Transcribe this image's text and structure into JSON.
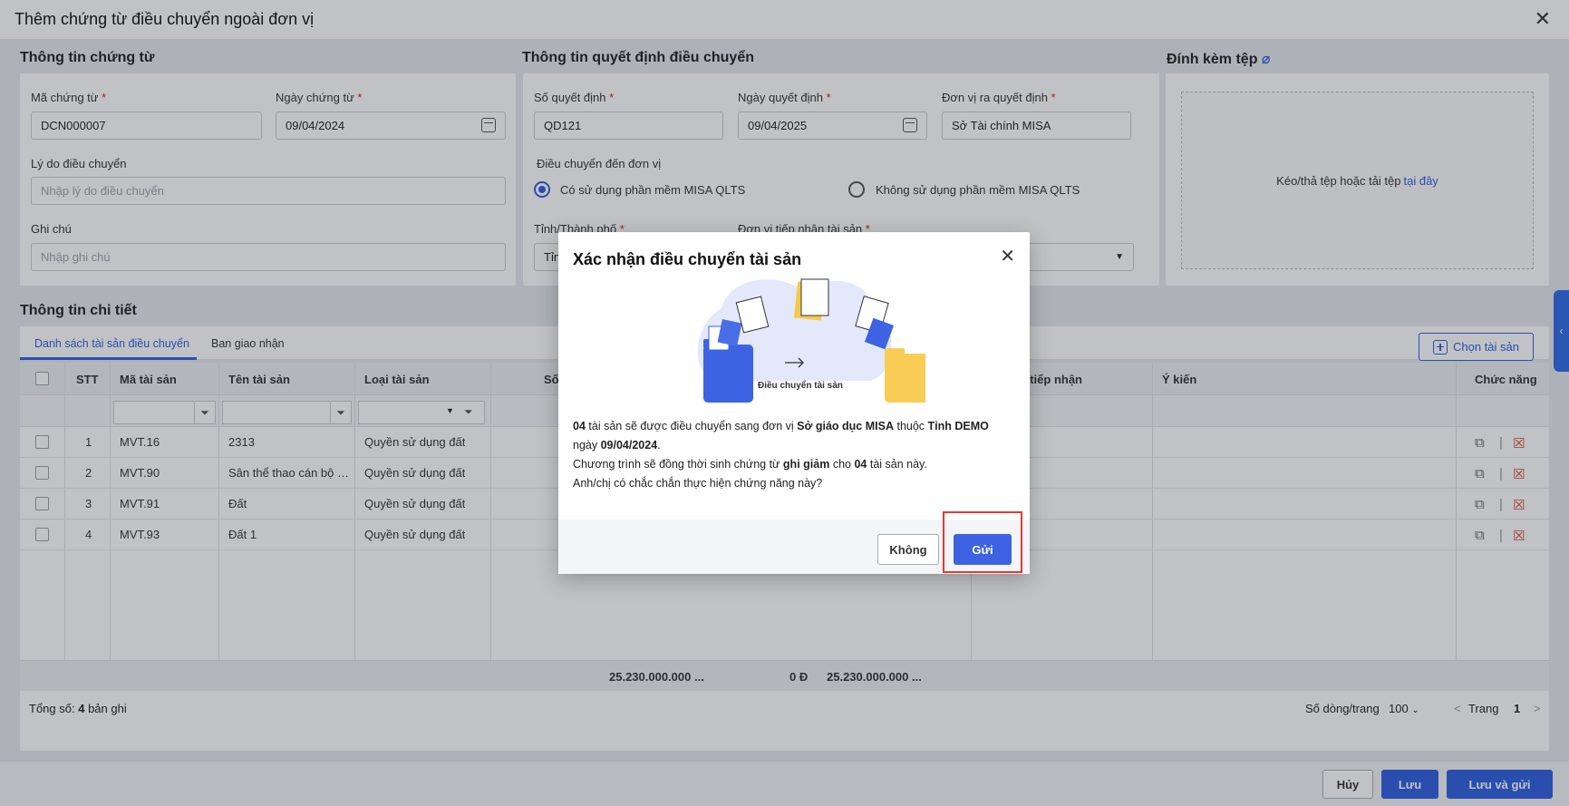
{
  "window": {
    "title": "Thêm chứng từ điều chuyển ngoài đơn vị"
  },
  "voucher_info": {
    "section_title": "Thông tin chứng từ",
    "code_label": "Mã chứng từ",
    "code_value": "DCN000007",
    "date_label": "Ngày chứng từ",
    "date_value": "09/04/2024",
    "reason_label": "Lý do điều chuyển",
    "reason_placeholder": "Nhập lý do điều chuyển",
    "note_label": "Ghi chú",
    "note_placeholder": "Nhập ghi chú"
  },
  "decision_info": {
    "section_title": "Thông tin quyết định điều chuyển",
    "number_label": "Số quyết định",
    "number_value": "QD121",
    "date_label": "Ngày quyết định",
    "date_value": "09/04/2025",
    "issuer_label": "Đơn vị ra quyết định",
    "issuer_value": "Sở Tài chính MISA",
    "transfer_to_label": "Điều chuyển đến đơn vị",
    "option_use": "Có sử dụng phần mềm MISA QLTS",
    "option_not_use": "Không sử dụng phần mềm MISA QLTS",
    "province_label": "Tỉnh/Thành phố",
    "province_value": "Tỉn",
    "receiver_label": "Đơn vị tiếp nhận tài sản"
  },
  "attachment": {
    "section_title": "Đính kèm tệp",
    "drop_text": "Kéo/thả tệp hoặc tải tệp",
    "drop_link": "tại đây"
  },
  "detail": {
    "section_title": "Thông tin chi tiết",
    "tabs": [
      {
        "label": "Danh sách tài sản điều chuyển"
      },
      {
        "label": "Ban giao nhận"
      }
    ],
    "choose_button": "Chọn tài sản",
    "columns": {
      "stt": "STT",
      "code": "Mã tài sản",
      "name": "Tên tài sản",
      "type": "Loại tài sản",
      "so": "Số",
      "receiver_unit": "i tiếp nhận",
      "opinion": "Ý kiến",
      "actions": "Chức năng"
    },
    "rows": [
      {
        "stt": "1",
        "code": "MVT.16",
        "name": "2313",
        "type": "Quyền sử dụng đất"
      },
      {
        "stt": "2",
        "code": "MVT.90",
        "name": "Sân thể thao cán bộ nhân viên",
        "type": "Quyền sử dụng đất"
      },
      {
        "stt": "3",
        "code": "MVT.91",
        "name": "Đất",
        "type": "Quyền sử dụng đất"
      },
      {
        "stt": "4",
        "code": "MVT.93",
        "name": "Đất 1",
        "type": "Quyền sử dụng đất"
      }
    ],
    "totals": {
      "a": "25.230.000.000 ...",
      "b": "0 Đ",
      "c": "25.230.000.000 ..."
    },
    "pager": {
      "total_prefix": "Tổng số:",
      "total_count": "4",
      "total_suffix": "bản ghi",
      "rows_per_page_label": "Số dòng/trang",
      "rows_per_page_value": "100",
      "page_label": "Trang",
      "page_value": "1"
    }
  },
  "footer": {
    "cancel": "Hủy",
    "save": "Lưu",
    "save_send": "Lưu và gửi"
  },
  "modal": {
    "title": "Xác nhận điều chuyển tài sản",
    "illustration_caption": "Điều chuyển tài sản",
    "count": "04",
    "t1": "tài sản sẽ được điều chuyển sang đơn vị",
    "unit": "Sở giáo dục MISA",
    "t2": "thuộc",
    "province": "Tỉnh DEMO",
    "t3": "ngày",
    "date": "09/04/2024",
    "t4": "Chương trình sẽ đồng thời sinh chứng từ",
    "bold_reduce": "ghi giảm",
    "t5": "cho",
    "count2": "04",
    "t6": "tài sản này.",
    "question": "Anh/chị có chắc chắn thực hiện chứng năng này?",
    "no_button": "Không",
    "send_button": "Gửi"
  },
  "colors": {
    "accent": "#2f5fe0",
    "highlight": "#e53935",
    "required": "#e02020"
  }
}
